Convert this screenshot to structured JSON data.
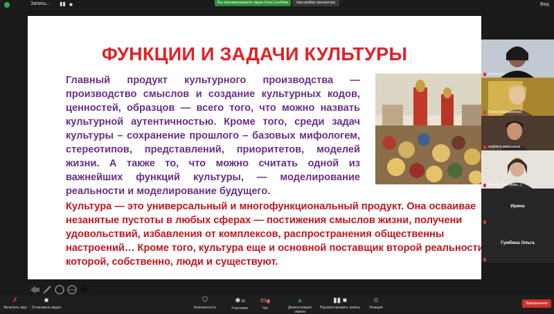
{
  "topbar": {
    "recording_label": "Запись...",
    "share_banner": "Вы просматриваете экран Irina Levshina",
    "view_options": "Настройки просмотра",
    "view_label": "Вид"
  },
  "slide": {
    "title": "ФУНКЦИИ И ЗАДАЧИ КУЛЬТУРЫ",
    "paragraph1": "Главный продукт культурного производства — производство смыслов и создание культурных кодов, ценностей, образцов — всего того, что можно назвать культурной аутентичностью. Кроме того, среди задач культуры – сохранение прошлого – базовых мифологем, стереотипов, представлений, приоритетов, моделей жизни. А также то, что можно считать одной из важнейших функций культуры, — моделирование реальности и моделирование будущего.",
    "paragraph2": "Культура — это универсальный и многофункциональный продукт. Она осваивае\nнезанятые пустоты в любых сферах — постижения смыслов жизни, получени\nудовольствий, избавления от комплексов, распространения общественны\nнастроений… Кроме того, культура еще и основной поставщик второй реальности,\nкоторой, собственно, люди и существуют."
  },
  "participants": [
    {
      "name": "Наталья"
    },
    {
      "name": "Елена Богомолова"
    },
    {
      "name": "нафиса ваисшина"
    },
    {
      "name": "iPhone (Беляева...)"
    },
    {
      "name": "Ирина"
    },
    {
      "name": "Гумбина Ольга"
    }
  ],
  "toolbar": {
    "audio": "Включить звук",
    "video": "Остановить видео",
    "security": "Безопасность",
    "participants": "Участники",
    "participants_count": "55",
    "chat": "Чат",
    "chat_badge": "2",
    "share": "Демонстрация экрана",
    "pause_record": "Пауза/остановить запись",
    "reactions": "Реакции",
    "end": "Завершение"
  },
  "colors": {
    "title_red": "#e21f26",
    "purple_text": "#6b2f86",
    "red_text": "#c0161f",
    "share_green": "#2f8f3a",
    "end_red": "#d0302a"
  }
}
